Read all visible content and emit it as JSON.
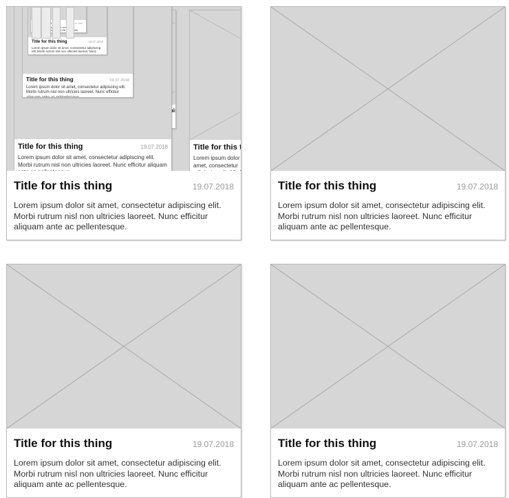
{
  "cards": [
    {
      "title": "Title for this thing",
      "date": "19.07.2018",
      "description": "Lorem ipsum dolor sit amet, consectetur adipiscing elit. Morbi rutrum nisl non ultricies laoreet. Nunc efficitur aliquam ante ac pellentesque.",
      "image": "recursive-card-preview"
    },
    {
      "title": "Title for this thing",
      "date": "19.07.2018",
      "description": "Lorem ipsum dolor sit amet, consectetur adipiscing elit. Morbi rutrum nisl non ultricies laoreet. Nunc efficitur aliquam ante ac pellentesque.",
      "image": "image-placeholder"
    },
    {
      "title": "Title for this thing",
      "date": "19.07.2018",
      "description": "Lorem ipsum dolor sit amet, consectetur adipiscing elit. Morbi rutrum nisl non ultricies laoreet. Nunc efficitur aliquam ante ac pellentesque.",
      "image": "image-placeholder"
    },
    {
      "title": "Title for this thing",
      "date": "19.07.2018",
      "description": "Lorem ipsum dolor sit amet, consectetur adipiscing elit. Morbi rutrum nisl non ultricies laoreet. Nunc efficitur aliquam ante ac pellentesque.",
      "image": "image-placeholder"
    }
  ],
  "colors": {
    "placeholder_fill": "#d6d6d6",
    "placeholder_stroke": "#a8a8a8",
    "card_border": "#b8b8b8",
    "date_text": "#9a9a9a"
  }
}
